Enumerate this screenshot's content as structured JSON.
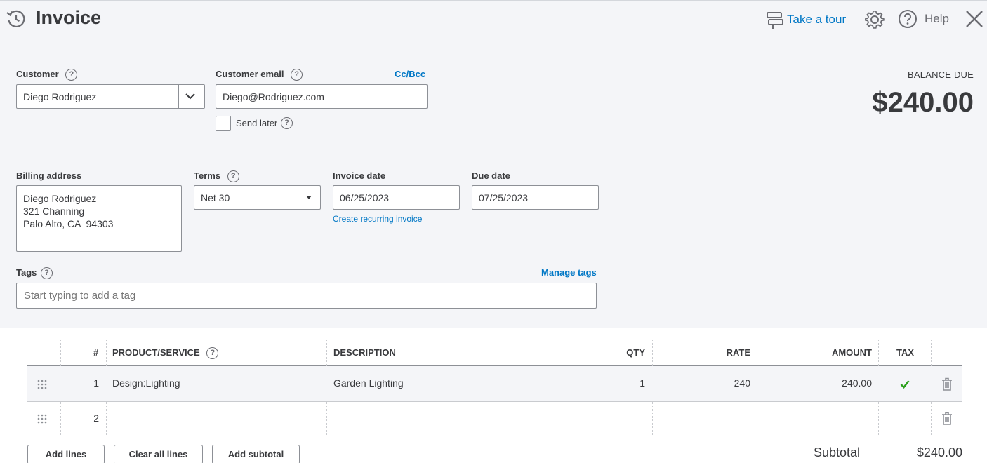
{
  "header": {
    "title": "Invoice",
    "take_tour": "Take a tour",
    "help": "Help"
  },
  "customer": {
    "label": "Customer",
    "value": "Diego Rodriguez"
  },
  "customer_email": {
    "label": "Customer email",
    "value": "Diego@Rodriguez.com",
    "cc_bcc": "Cc/Bcc",
    "send_later": "Send later",
    "send_later_checked": false
  },
  "balance": {
    "label": "BALANCE DUE",
    "amount": "$240.00"
  },
  "billing": {
    "label": "Billing address",
    "line1": "Diego Rodriguez",
    "line2": "321 Channing",
    "line3": "Palo Alto, CA  94303"
  },
  "terms": {
    "label": "Terms",
    "value": "Net 30"
  },
  "invoice_date": {
    "label": "Invoice date",
    "value": "06/25/2023",
    "recurring_link": "Create recurring invoice"
  },
  "due_date": {
    "label": "Due date",
    "value": "07/25/2023"
  },
  "tags": {
    "label": "Tags",
    "manage": "Manage tags",
    "placeholder": "Start typing to add a tag"
  },
  "table": {
    "headers": {
      "num": "#",
      "product": "PRODUCT/SERVICE",
      "description": "DESCRIPTION",
      "qty": "QTY",
      "rate": "RATE",
      "amount": "AMOUNT",
      "tax": "TAX"
    },
    "rows": [
      {
        "num": "1",
        "product": "Design:Lighting",
        "description": "Garden Lighting",
        "qty": "1",
        "rate": "240",
        "amount": "240.00",
        "tax": true
      },
      {
        "num": "2",
        "product": "",
        "description": "",
        "qty": "",
        "rate": "",
        "amount": "",
        "tax": false
      }
    ]
  },
  "buttons": {
    "add_lines": "Add lines",
    "clear_all": "Clear all lines",
    "add_subtotal": "Add subtotal"
  },
  "subtotal": {
    "label": "Subtotal",
    "value": "$240.00"
  },
  "colors": {
    "link": "#0077c5",
    "check": "#2ca01c",
    "top_bg": "#f4f5f8"
  }
}
